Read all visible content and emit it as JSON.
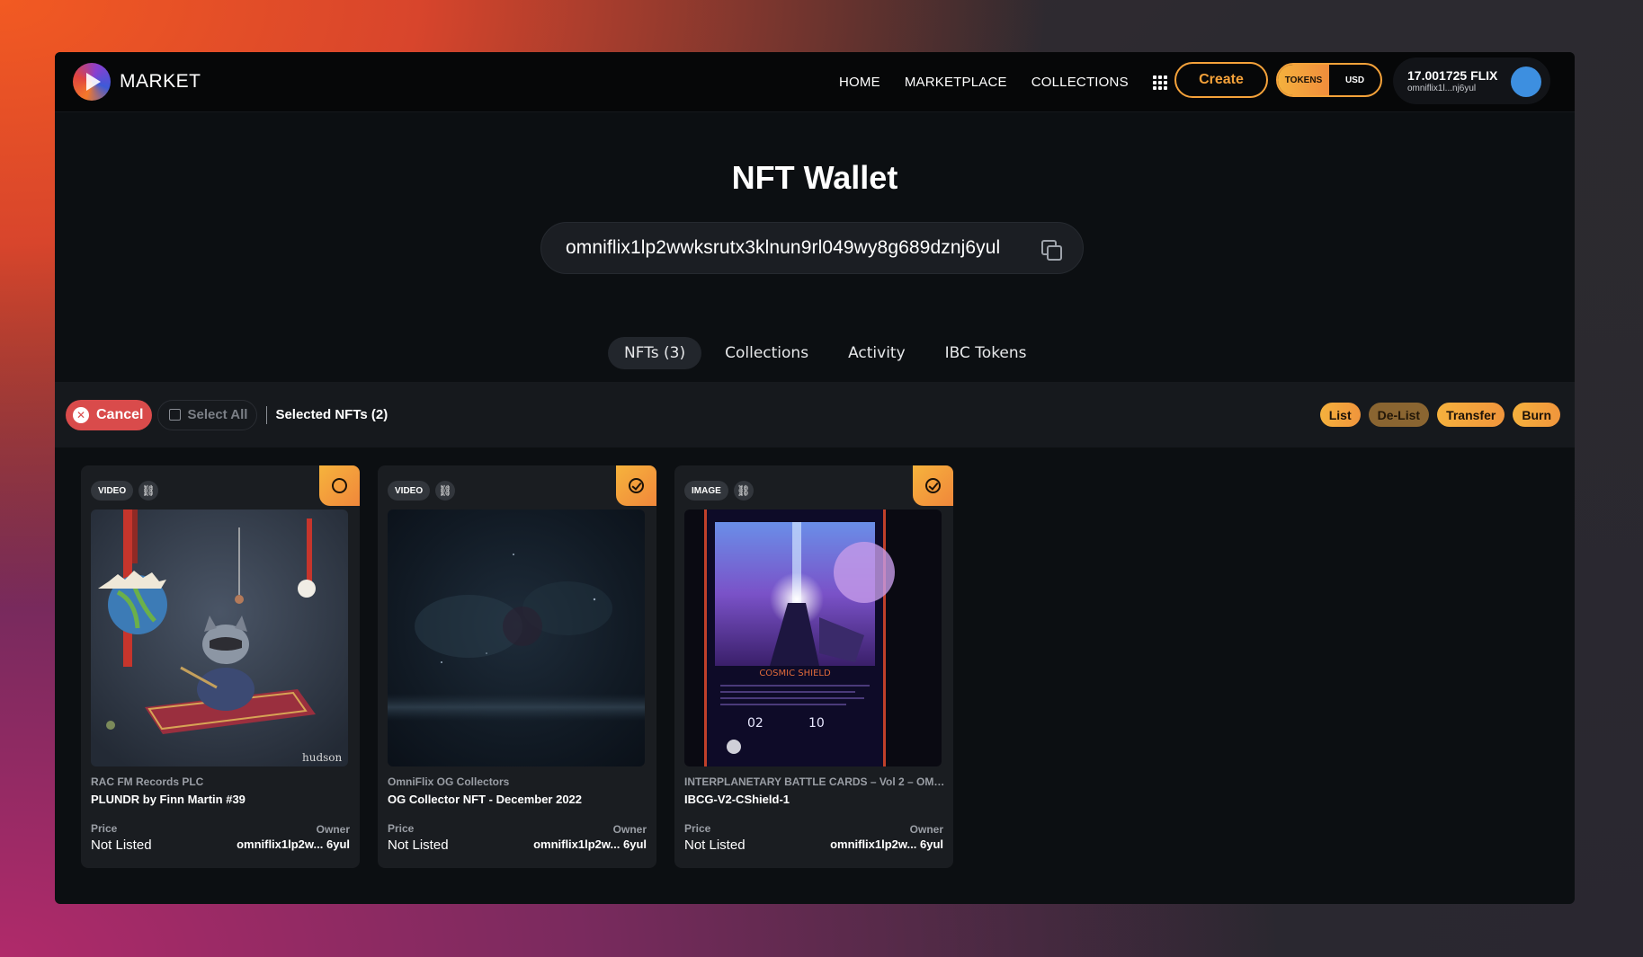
{
  "header": {
    "logo_text": "MARKET",
    "nav": [
      "HOME",
      "MARKETPLACE",
      "COLLECTIONS"
    ],
    "create_label": "Create",
    "currency_options": [
      "TOKENS",
      "USD"
    ],
    "currency_selected": "TOKENS",
    "balance": "17.001725 FLIX",
    "account_address": "omniflix1l...nj6yul",
    "avatar_color": "#3d8fe0"
  },
  "hero": {
    "title": "NFT Wallet",
    "address": "omniflix1lp2wwksrutx3klnun9rl049wy8g689dznj6yul"
  },
  "tabs": [
    {
      "label": "NFTs (3)",
      "active": true
    },
    {
      "label": "Collections",
      "active": false
    },
    {
      "label": "Activity",
      "active": false
    },
    {
      "label": "IBC Tokens",
      "active": false
    }
  ],
  "toolbar": {
    "cancel_label": "Cancel",
    "select_all_label": "Select All",
    "selected_label": "Selected NFTs (2)",
    "actions": [
      "List",
      "De-List",
      "Transfer",
      "Burn"
    ]
  },
  "cards": [
    {
      "media_type": "VIDEO",
      "selected": false,
      "collection": "RAC FM Records PLC",
      "name": "PLUNDR by Finn Martin #39",
      "price_label": "Price",
      "price": "Not Listed",
      "owner_label": "Owner",
      "owner": "omniflix1lp2w... 6yul"
    },
    {
      "media_type": "VIDEO",
      "selected": true,
      "collection": "OmniFlix OG Collectors",
      "name": "OG Collector NFT - December 2022",
      "price_label": "Price",
      "price": "Not Listed",
      "owner_label": "Owner",
      "owner": "omniflix1lp2w... 6yul"
    },
    {
      "media_type": "IMAGE",
      "selected": true,
      "collection": "INTERPLANETARY BATTLE CARDS – Vol 2 – OMNI...",
      "name": "IBCG-V2-CShield-1",
      "price_label": "Price",
      "price": "Not Listed",
      "owner_label": "Owner",
      "owner": "omniflix1lp2w... 6yul"
    }
  ],
  "colors": {
    "accent": "#f5a23a",
    "cancel": "#d94b4b"
  },
  "icons": {
    "apps": "grid-icon",
    "copy": "copy-icon",
    "cancel": "x-circle-icon",
    "link": "link-icon",
    "select": "circle-check-icon"
  }
}
